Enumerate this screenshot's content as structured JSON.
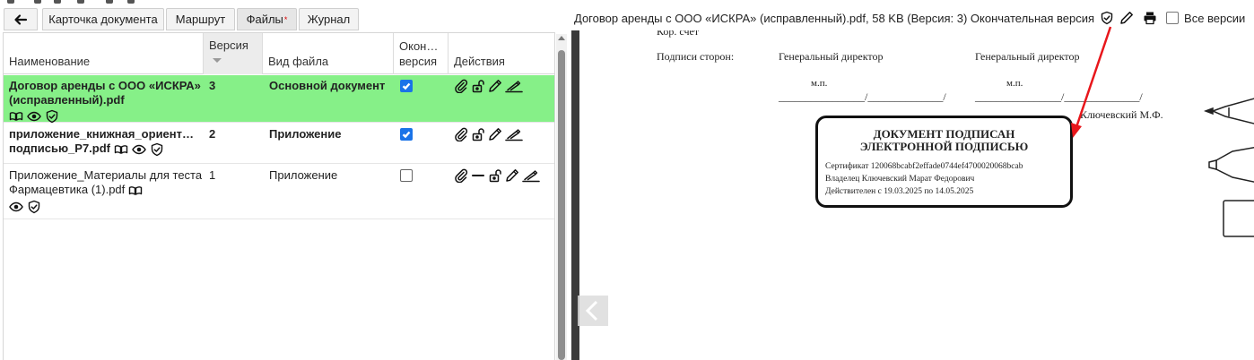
{
  "tabs": [
    {
      "label": "Карточка документа"
    },
    {
      "label": "Маршрут"
    },
    {
      "label": "Файлы",
      "required_mark": "*"
    },
    {
      "label": "Журнал"
    }
  ],
  "grid": {
    "headers": {
      "name": "Наименование",
      "version": "Версия",
      "type": "Вид файла",
      "final": "Окон… версия",
      "actions": "Действия"
    },
    "rows": [
      {
        "name": "Договор аренды с ООО «ИСКРА» (исправленный).pdf",
        "version": "3",
        "type": "Основной документ",
        "final": true,
        "bold": true,
        "selected": true,
        "actions": [
          "paperclip-icon",
          "unlock-icon",
          "pencil-icon",
          "sign-icon"
        ]
      },
      {
        "name": "приложение_книжная_ориент… подписью_P7.pdf",
        "version": "2",
        "type": "Приложение",
        "final": true,
        "bold": true,
        "selected": false,
        "actions": [
          "paperclip-icon",
          "unlock-icon",
          "pencil-icon",
          "sign-icon"
        ]
      },
      {
        "name": "Приложение_Материалы для теста Фармацевтика (1).pdf",
        "version": "1",
        "type": "Приложение",
        "final": false,
        "bold": false,
        "selected": false,
        "actions": [
          "paperclip-icon",
          "minus-icon",
          "unlock-icon",
          "pencil-icon",
          "sign-icon"
        ]
      }
    ]
  },
  "doc_header": {
    "title": "Договор аренды с ООО «ИСКРА» (исправленный).pdf, 58 KB (Версия: 3) Окончательная версия",
    "all_versions_label": "Все версии"
  },
  "pdf": {
    "corr_account": "Кор. счет",
    "signatures_label": "Подписи сторон:",
    "party1": "Генеральный директор",
    "party2": "Генеральный директор",
    "mp1": "м.п.",
    "mp2": "м.п.",
    "line1": "________________/______________/",
    "line2": "________________/______________/",
    "signer": "Ключевский М.Ф.",
    "stamp": {
      "title1": "ДОКУМЕНТ ПОДПИСАН",
      "title2": "ЭЛЕКТРОННОЙ ПОДПИСЬЮ",
      "cert": "Сертификат 120068bcabf2effade0744ef4700020068bcab",
      "owner": "Владелец Ключевский Марат Федорович",
      "valid": "Действителен с 19.03.2025 по 14.05.2025"
    }
  },
  "colors": {
    "selected_row": "#86f088",
    "checkbox": "#1a73e8",
    "annotation_arrow": "#e8161b"
  }
}
